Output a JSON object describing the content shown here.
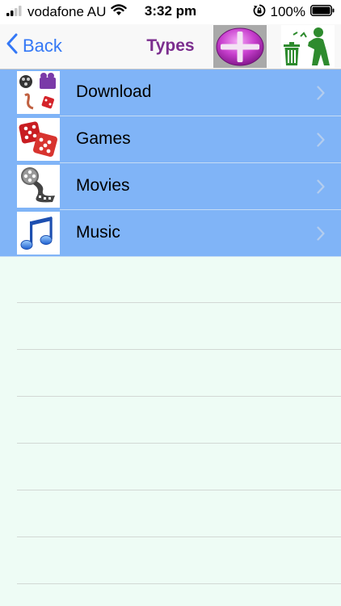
{
  "status_bar": {
    "carrier": "vodafone AU",
    "time": "3:32 pm",
    "battery": "100%",
    "icons": [
      "signal-icon",
      "wifi-icon",
      "rotation-lock-icon",
      "battery-icon"
    ]
  },
  "nav": {
    "back_label": "Back",
    "title": "Types",
    "icons": [
      "chevron-left-icon",
      "plus-icon",
      "trash-person-icon"
    ]
  },
  "list": {
    "items": [
      {
        "label": "Download",
        "icon": "download-collage-icon"
      },
      {
        "label": "Games",
        "icon": "dice-icon"
      },
      {
        "label": "Movies",
        "icon": "film-reel-icon"
      },
      {
        "label": "Music",
        "icon": "music-note-icon"
      }
    ]
  },
  "colors": {
    "accent": "#3478f6",
    "title": "#7b2d8e",
    "row_background": "#80b4f7",
    "page_background": "#eefcf5",
    "add_button": "#a9a9a9"
  }
}
